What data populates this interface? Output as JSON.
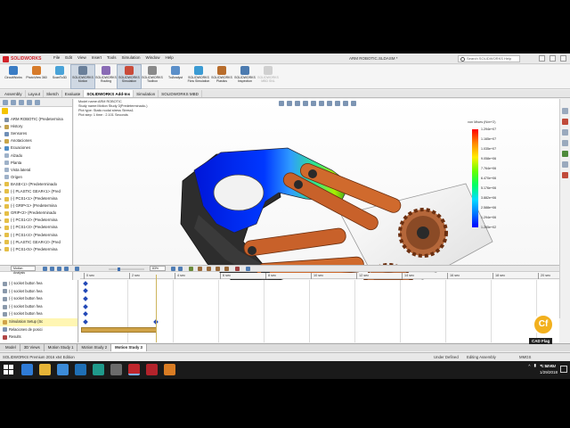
{
  "app": {
    "brand": "SOLIDWORKS",
    "menu": [
      "File",
      "Edit",
      "View",
      "Insert",
      "Tools",
      "Simulation",
      "Window",
      "Help"
    ],
    "document_title": "ARM ROBOTIC.SLDASM *",
    "search_placeholder": "Search SOLIDWORKS Help"
  },
  "ribbon": [
    {
      "label": "CircuitWorks",
      "color": "#3a7cc4",
      "active": false
    },
    {
      "label": "PhotoView 360",
      "color": "#d77b2a",
      "active": false
    },
    {
      "label": "ScanTo3D",
      "color": "#4aa3d8",
      "active": false
    },
    {
      "label": "SOLIDWORKS Motion",
      "color": "#6a7f99",
      "active": true
    },
    {
      "label": "SOLIDWORKS Routing",
      "color": "#8a6bb5",
      "active": false
    },
    {
      "label": "SOLIDWORKS Simulation",
      "color": "#c94b3a",
      "active": true
    },
    {
      "label": "SOLIDWORKS Toolbox",
      "color": "#8a8a8a",
      "active": false
    },
    {
      "label": "TolAnalyst",
      "color": "#5b8fc9",
      "active": false
    },
    {
      "label": "SOLIDWORKS Flow Simulation",
      "color": "#3b9bd3",
      "active": false
    },
    {
      "label": "SOLIDWORKS Plastics",
      "color": "#b86d2c",
      "active": false
    },
    {
      "label": "SOLIDWORKS Inspection",
      "color": "#4c7bb0",
      "active": false
    },
    {
      "label": "SOLIDWORKS MBD SNL",
      "color": "#999999",
      "active": false
    }
  ],
  "command_tabs": [
    "Assembly",
    "Layout",
    "Sketch",
    "Evaluate",
    "SOLIDWORKS Add-Ins",
    "Simulation",
    "SOLIDWORKS MBD"
  ],
  "command_tab_active": 4,
  "feature_tree": [
    {
      "label": "ARM ROBOTIC  (Predetermina",
      "icon": "#7d8fa6",
      "arrow": ""
    },
    {
      "label": "History",
      "icon": "#c3a24d",
      "arrow": "▸"
    },
    {
      "label": "Sensores",
      "icon": "#6f8fb7",
      "arrow": ""
    },
    {
      "label": "Anotaciones",
      "icon": "#c9a64b",
      "arrow": "▸"
    },
    {
      "label": "Ecuaciones",
      "icon": "#4f8dc7",
      "arrow": "▸"
    },
    {
      "label": "Alzado",
      "icon": "#9fb2c9",
      "arrow": ""
    },
    {
      "label": "Planta",
      "icon": "#9fb2c9",
      "arrow": ""
    },
    {
      "label": "Vista lateral",
      "icon": "#9fb2c9",
      "arrow": ""
    },
    {
      "label": "Origen",
      "icon": "#9fb2c9",
      "arrow": ""
    },
    {
      "label": "BASE<1> (Predeterminado",
      "icon": "#e5bf47",
      "arrow": "▸"
    },
    {
      "label": "(-) PLASTIC GEAR<1> (Pred",
      "icon": "#e5bf47",
      "arrow": "▸"
    },
    {
      "label": "(-) PCS1<1> (Predetermina",
      "icon": "#e5bf47",
      "arrow": "▸"
    },
    {
      "label": "(-) GRIP<1> (Predetermina",
      "icon": "#e5bf47",
      "arrow": "▸"
    },
    {
      "label": "GRIP<2> (Predeterminado",
      "icon": "#e5bf47",
      "arrow": "▸"
    },
    {
      "label": "(-) PCS1<2> (Predetermina",
      "icon": "#e5bf47",
      "arrow": "▸"
    },
    {
      "label": "(-) PCS1<3> (Predetermina",
      "icon": "#e5bf47",
      "arrow": "▸"
    },
    {
      "label": "(-) PCS1<4> (Predetermina",
      "icon": "#e5bf47",
      "arrow": "▸"
    },
    {
      "label": "(-) PLASTIC GEAR<2> (Pred",
      "icon": "#e5bf47",
      "arrow": "▸"
    },
    {
      "label": "(-) PCS1<5> (Predetermina",
      "icon": "#e5bf47",
      "arrow": "▸"
    }
  ],
  "study_info": [
    "Model name:ARM ROBOTIC",
    "Study name:Motion Study 3(Predeterminado-)",
    "Plot type: Static nodal stress Stress1",
    "Plot step: 1   time : 2.101 Seconds"
  ],
  "legend": {
    "title": "von Mises (N/m^2)",
    "values": [
      "1.294e+07",
      "1.165e+07",
      "1.035e+07",
      "9.058e+06",
      "7.764e+06",
      "6.470e+06",
      "5.176e+06",
      "3.882e+06",
      "2.588e+06",
      "1.294e+06",
      "1.265e+02"
    ]
  },
  "motion_manager": {
    "label": "Motion Analysis",
    "zoom": "83%",
    "ticks": [
      "0 sec",
      "2 sec",
      "4 sec",
      "6 sec",
      "8 sec",
      "10 sec",
      "12 sec",
      "14 sec",
      "16 sec",
      "18 sec",
      "20 sec"
    ],
    "tree": [
      {
        "label": "(-) socket button hea",
        "icon": "#8a99ab",
        "sel": false
      },
      {
        "label": "(-) socket button hea",
        "icon": "#8a99ab",
        "sel": false
      },
      {
        "label": "(-) socket button hea",
        "icon": "#8a99ab",
        "sel": false
      },
      {
        "label": "(-) socket button hea",
        "icon": "#8a99ab",
        "sel": false
      },
      {
        "label": "(-) socket button hea",
        "icon": "#8a99ab",
        "sel": false
      },
      {
        "label": "Simulation Setup (Sc",
        "icon": "#d0a348",
        "sel": true
      },
      {
        "label": "Relaciones de posici",
        "icon": "#7e93b0",
        "sel": false
      },
      {
        "label": "Results",
        "icon": "#b04646",
        "sel": false
      }
    ]
  },
  "bottom_tabs": [
    "Model",
    "3D Views",
    "Motion Study 1",
    "Motion Study 2",
    "Motion Study 3"
  ],
  "bottom_tab_active": 4,
  "status": {
    "left": "SOLIDWORKS Premium 2016 x64 Edition",
    "state": "Under Defined",
    "editing": "Editing Assembly",
    "units": "MMGS"
  },
  "watermark": {
    "badge": "Cf",
    "text": "CAD Flag"
  },
  "taskbar": {
    "apps": [
      {
        "name": "edge",
        "color": "#2f7bd6"
      },
      {
        "name": "explorer",
        "color": "#e6b437"
      },
      {
        "name": "store",
        "color": "#3c8bd8"
      },
      {
        "name": "lync",
        "color": "#1f6fb5"
      },
      {
        "name": "app-teal",
        "color": "#1f9a8b"
      },
      {
        "name": "app-gray",
        "color": "#6b6b6b"
      },
      {
        "name": "solidworks",
        "color": "#c0262c"
      },
      {
        "name": "app-red",
        "color": "#b3232b"
      },
      {
        "name": "app-orange",
        "color": "#d97c23"
      }
    ],
    "lang": "ENG",
    "time": "1:54 AM",
    "date": "1/29/2018"
  }
}
